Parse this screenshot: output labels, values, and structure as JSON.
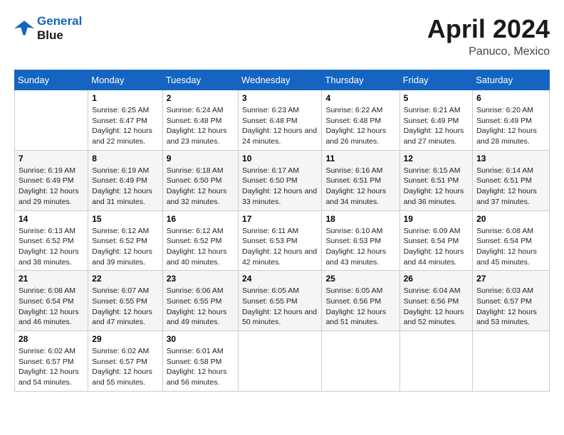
{
  "header": {
    "logo_line1": "General",
    "logo_line2": "Blue",
    "month": "April 2024",
    "location": "Panuco, Mexico"
  },
  "weekdays": [
    "Sunday",
    "Monday",
    "Tuesday",
    "Wednesday",
    "Thursday",
    "Friday",
    "Saturday"
  ],
  "weeks": [
    [
      {
        "day": "",
        "sunrise": "",
        "sunset": "",
        "daylight": ""
      },
      {
        "day": "1",
        "sunrise": "Sunrise: 6:25 AM",
        "sunset": "Sunset: 6:47 PM",
        "daylight": "Daylight: 12 hours and 22 minutes."
      },
      {
        "day": "2",
        "sunrise": "Sunrise: 6:24 AM",
        "sunset": "Sunset: 6:48 PM",
        "daylight": "Daylight: 12 hours and 23 minutes."
      },
      {
        "day": "3",
        "sunrise": "Sunrise: 6:23 AM",
        "sunset": "Sunset: 6:48 PM",
        "daylight": "Daylight: 12 hours and 24 minutes."
      },
      {
        "day": "4",
        "sunrise": "Sunrise: 6:22 AM",
        "sunset": "Sunset: 6:48 PM",
        "daylight": "Daylight: 12 hours and 26 minutes."
      },
      {
        "day": "5",
        "sunrise": "Sunrise: 6:21 AM",
        "sunset": "Sunset: 6:49 PM",
        "daylight": "Daylight: 12 hours and 27 minutes."
      },
      {
        "day": "6",
        "sunrise": "Sunrise: 6:20 AM",
        "sunset": "Sunset: 6:49 PM",
        "daylight": "Daylight: 12 hours and 28 minutes."
      }
    ],
    [
      {
        "day": "7",
        "sunrise": "Sunrise: 6:19 AM",
        "sunset": "Sunset: 6:49 PM",
        "daylight": "Daylight: 12 hours and 29 minutes."
      },
      {
        "day": "8",
        "sunrise": "Sunrise: 6:19 AM",
        "sunset": "Sunset: 6:49 PM",
        "daylight": "Daylight: 12 hours and 31 minutes."
      },
      {
        "day": "9",
        "sunrise": "Sunrise: 6:18 AM",
        "sunset": "Sunset: 6:50 PM",
        "daylight": "Daylight: 12 hours and 32 minutes."
      },
      {
        "day": "10",
        "sunrise": "Sunrise: 6:17 AM",
        "sunset": "Sunset: 6:50 PM",
        "daylight": "Daylight: 12 hours and 33 minutes."
      },
      {
        "day": "11",
        "sunrise": "Sunrise: 6:16 AM",
        "sunset": "Sunset: 6:51 PM",
        "daylight": "Daylight: 12 hours and 34 minutes."
      },
      {
        "day": "12",
        "sunrise": "Sunrise: 6:15 AM",
        "sunset": "Sunset: 6:51 PM",
        "daylight": "Daylight: 12 hours and 36 minutes."
      },
      {
        "day": "13",
        "sunrise": "Sunrise: 6:14 AM",
        "sunset": "Sunset: 6:51 PM",
        "daylight": "Daylight: 12 hours and 37 minutes."
      }
    ],
    [
      {
        "day": "14",
        "sunrise": "Sunrise: 6:13 AM",
        "sunset": "Sunset: 6:52 PM",
        "daylight": "Daylight: 12 hours and 38 minutes."
      },
      {
        "day": "15",
        "sunrise": "Sunrise: 6:12 AM",
        "sunset": "Sunset: 6:52 PM",
        "daylight": "Daylight: 12 hours and 39 minutes."
      },
      {
        "day": "16",
        "sunrise": "Sunrise: 6:12 AM",
        "sunset": "Sunset: 6:52 PM",
        "daylight": "Daylight: 12 hours and 40 minutes."
      },
      {
        "day": "17",
        "sunrise": "Sunrise: 6:11 AM",
        "sunset": "Sunset: 6:53 PM",
        "daylight": "Daylight: 12 hours and 42 minutes."
      },
      {
        "day": "18",
        "sunrise": "Sunrise: 6:10 AM",
        "sunset": "Sunset: 6:53 PM",
        "daylight": "Daylight: 12 hours and 43 minutes."
      },
      {
        "day": "19",
        "sunrise": "Sunrise: 6:09 AM",
        "sunset": "Sunset: 6:54 PM",
        "daylight": "Daylight: 12 hours and 44 minutes."
      },
      {
        "day": "20",
        "sunrise": "Sunrise: 6:08 AM",
        "sunset": "Sunset: 6:54 PM",
        "daylight": "Daylight: 12 hours and 45 minutes."
      }
    ],
    [
      {
        "day": "21",
        "sunrise": "Sunrise: 6:08 AM",
        "sunset": "Sunset: 6:54 PM",
        "daylight": "Daylight: 12 hours and 46 minutes."
      },
      {
        "day": "22",
        "sunrise": "Sunrise: 6:07 AM",
        "sunset": "Sunset: 6:55 PM",
        "daylight": "Daylight: 12 hours and 47 minutes."
      },
      {
        "day": "23",
        "sunrise": "Sunrise: 6:06 AM",
        "sunset": "Sunset: 6:55 PM",
        "daylight": "Daylight: 12 hours and 49 minutes."
      },
      {
        "day": "24",
        "sunrise": "Sunrise: 6:05 AM",
        "sunset": "Sunset: 6:55 PM",
        "daylight": "Daylight: 12 hours and 50 minutes."
      },
      {
        "day": "25",
        "sunrise": "Sunrise: 6:05 AM",
        "sunset": "Sunset: 6:56 PM",
        "daylight": "Daylight: 12 hours and 51 minutes."
      },
      {
        "day": "26",
        "sunrise": "Sunrise: 6:04 AM",
        "sunset": "Sunset: 6:56 PM",
        "daylight": "Daylight: 12 hours and 52 minutes."
      },
      {
        "day": "27",
        "sunrise": "Sunrise: 6:03 AM",
        "sunset": "Sunset: 6:57 PM",
        "daylight": "Daylight: 12 hours and 53 minutes."
      }
    ],
    [
      {
        "day": "28",
        "sunrise": "Sunrise: 6:02 AM",
        "sunset": "Sunset: 6:57 PM",
        "daylight": "Daylight: 12 hours and 54 minutes."
      },
      {
        "day": "29",
        "sunrise": "Sunrise: 6:02 AM",
        "sunset": "Sunset: 6:57 PM",
        "daylight": "Daylight: 12 hours and 55 minutes."
      },
      {
        "day": "30",
        "sunrise": "Sunrise: 6:01 AM",
        "sunset": "Sunset: 6:58 PM",
        "daylight": "Daylight: 12 hours and 56 minutes."
      },
      {
        "day": "",
        "sunrise": "",
        "sunset": "",
        "daylight": ""
      },
      {
        "day": "",
        "sunrise": "",
        "sunset": "",
        "daylight": ""
      },
      {
        "day": "",
        "sunrise": "",
        "sunset": "",
        "daylight": ""
      },
      {
        "day": "",
        "sunrise": "",
        "sunset": "",
        "daylight": ""
      }
    ]
  ]
}
